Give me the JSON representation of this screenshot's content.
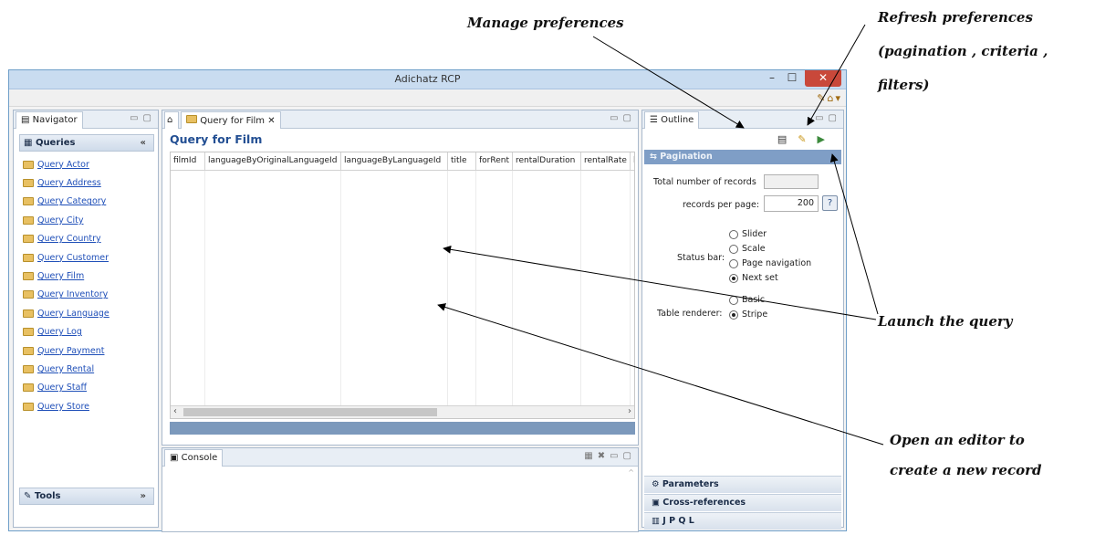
{
  "annotations": {
    "manage": "Manage preferences",
    "refresh_line1": "Refresh preferences",
    "refresh_line2": "(pagination , criteria ,",
    "refresh_line3": "filters)",
    "launch": "Launch the query",
    "open_editor_line1": "Open an editor to",
    "open_editor_line2": "create a new record"
  },
  "window": {
    "title": "Adichatz RCP",
    "min": "–",
    "max": "☐",
    "close": "✕"
  },
  "navigator": {
    "tab": "Navigator",
    "queries_section": "Queries",
    "tools_section": "Tools",
    "items": [
      "Query Actor",
      "Query Address",
      "Query Category",
      "Query City",
      "Query Country",
      "Query Customer",
      "Query Film",
      "Query Inventory",
      "Query Language",
      "Query Log",
      "Query Payment",
      "Query Rental",
      "Query Staff",
      "Query Store"
    ]
  },
  "editor": {
    "tab": "Query for Film",
    "title": "Query for Film",
    "columns": [
      "filmId",
      "languageByOriginalLanguageId",
      "languageByLanguageId",
      "title",
      "forRent",
      "rentalDuration",
      "rentalRate",
      "le"
    ]
  },
  "console": {
    "tab": "Console"
  },
  "outline": {
    "tab": "Outline",
    "pagination": {
      "header": "Pagination",
      "total_label": "Total number of records",
      "total_value": "",
      "per_page_label": "records per page:",
      "per_page_value": "200",
      "help": "?",
      "status_bar_label": "Status bar:",
      "status_options": [
        "Slider",
        "Scale",
        "Page navigation",
        "Next set"
      ],
      "status_selected": "Next set",
      "renderer_label": "Table renderer:",
      "renderer_options": [
        "Basic",
        "Stripe"
      ],
      "renderer_selected": "Stripe"
    },
    "bottom_sections": [
      "Parameters",
      "Cross-references",
      "J P Q L"
    ]
  },
  "colors": {
    "accent": "#234f93",
    "pagination_header": "#7f9ec6",
    "status_bar": "#7c99bc",
    "link": "#1f4fb8"
  }
}
